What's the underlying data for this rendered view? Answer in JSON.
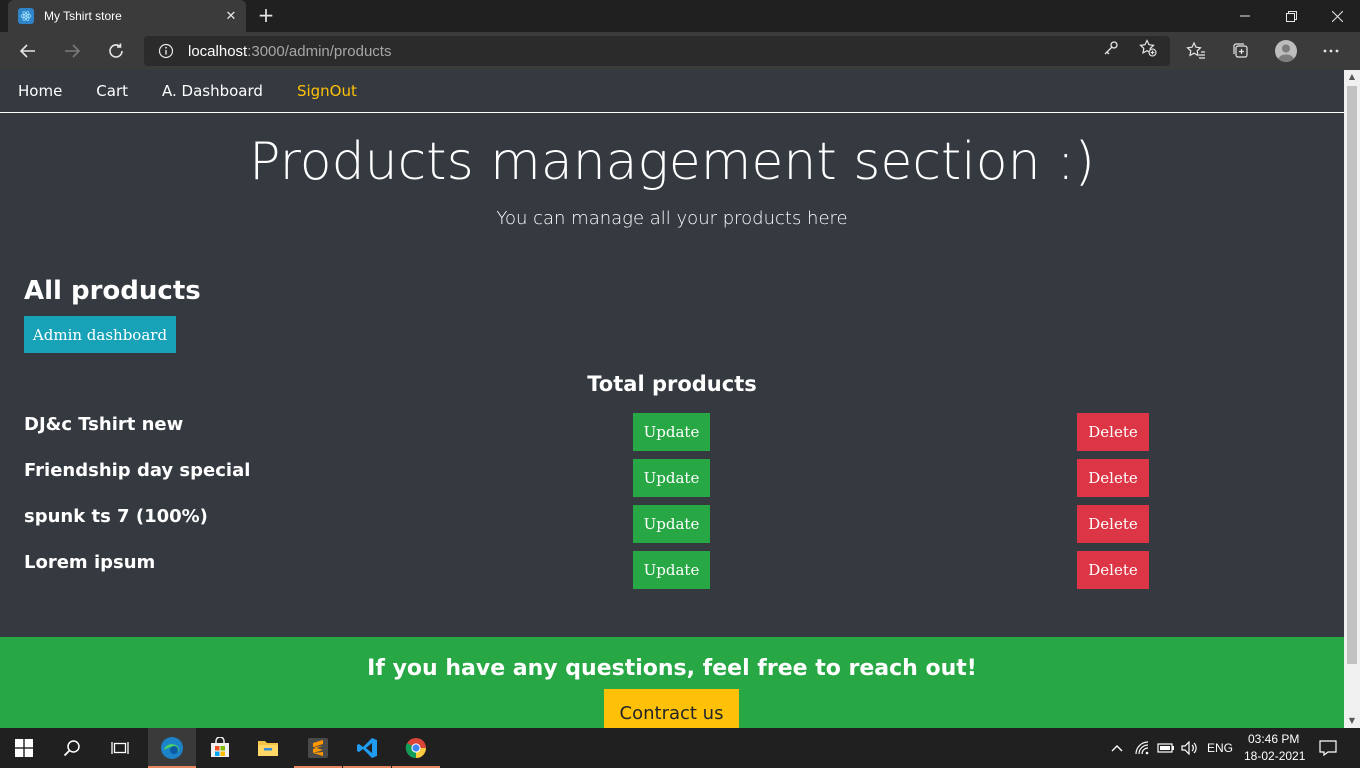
{
  "browser": {
    "tab_title": "My Tshirt store",
    "tab_close": "✕",
    "new_tab": "+",
    "url_host": "localhost",
    "url_path": ":3000/admin/products"
  },
  "nav": {
    "items": [
      {
        "label": "Home",
        "active": false
      },
      {
        "label": "Cart",
        "active": false
      },
      {
        "label": "A. Dashboard",
        "active": false
      },
      {
        "label": "SignOut",
        "active": true
      }
    ]
  },
  "hero": {
    "title": "Products management section :)",
    "subtitle": "You can manage all your products here"
  },
  "products_section": {
    "heading": "All products",
    "admin_button": "Admin dashboard",
    "total_heading": "Total products",
    "update_label": "Update",
    "delete_label": "Delete",
    "items": [
      {
        "name": "DJ&c Tshirt new"
      },
      {
        "name": "Friendship day special"
      },
      {
        "name": "spunk ts 7 (100%)"
      },
      {
        "name": "Lorem ipsum"
      }
    ]
  },
  "footer": {
    "text": "If you have any questions, feel free to reach out!",
    "contact_button": "Contract us"
  },
  "taskbar": {
    "language": "ENG",
    "time": "03:46 PM",
    "date": "18-02-2021"
  },
  "colors": {
    "page_bg": "#343a40",
    "info": "#17a2b8",
    "success": "#28a745",
    "danger": "#dc3545",
    "warning": "#ffc107"
  }
}
